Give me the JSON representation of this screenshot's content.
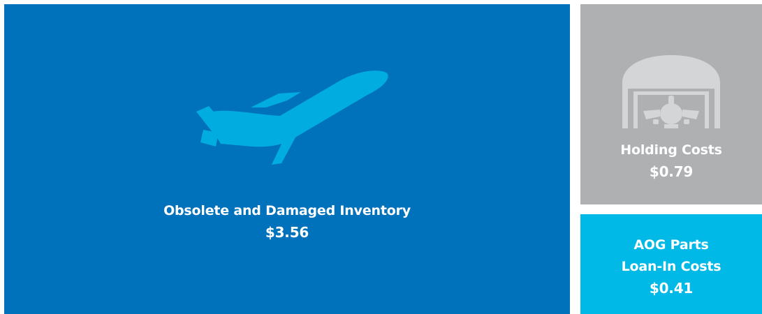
{
  "chart_data": {
    "type": "treemap",
    "units": "$",
    "items": [
      {
        "label": "Obsolete and Damaged Inventory",
        "value": 3.56,
        "display_value": "$3.56",
        "color": "#0072BC",
        "icon": "airplane-takeoff-icon"
      },
      {
        "label": "Holding Costs",
        "value": 0.79,
        "display_value": "$0.79",
        "color": "#AEB0B2",
        "icon": "hangar-icon"
      },
      {
        "label_lines": [
          "AOG Parts",
          "Loan-In Costs"
        ],
        "value": 0.41,
        "display_value": "$0.41",
        "color": "#00B9E6"
      }
    ]
  },
  "colors": {
    "plane_icon": "#00ACE0",
    "hangar_icon": "#D4D5D7"
  }
}
